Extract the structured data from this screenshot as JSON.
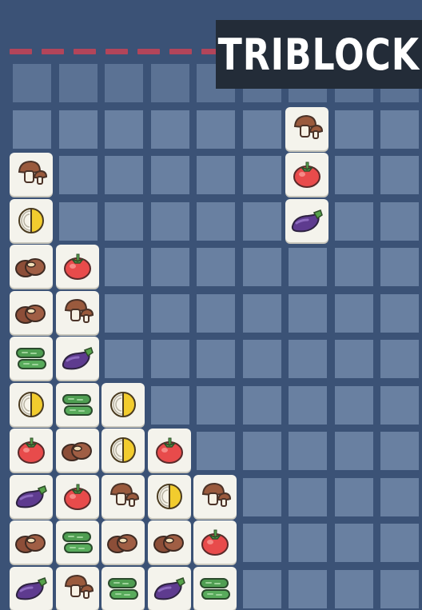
{
  "game": {
    "title": "TRIBLOCK",
    "grid": {
      "columns": 9,
      "rows": 12
    },
    "colors": {
      "background": "#3b5276",
      "empty_cell": "#6c83a3",
      "danger_line": "#b2455a",
      "tile": "#f4f3ec",
      "title_bg": "#232c38"
    },
    "falling_piece": {
      "column": 6,
      "top_row": 1,
      "tiles": [
        "mushroom",
        "tomato",
        "eggplant"
      ]
    },
    "stacks": [
      [
        "mushroom",
        "lemon",
        "potato",
        "potato",
        "cucumber",
        "lemon",
        "tomato",
        "eggplant",
        "potato",
        "eggplant"
      ],
      [
        "tomato",
        "mushroom",
        "eggplant",
        "cucumber",
        "potato",
        "tomato",
        "cucumber",
        "mushroom"
      ],
      [
        "lemon",
        "lemon",
        "mushroom",
        "potato",
        "cucumber"
      ],
      [
        "tomato",
        "lemon",
        "potato",
        "eggplant"
      ],
      [
        "mushroom",
        "tomato",
        "cucumber"
      ]
    ]
  }
}
